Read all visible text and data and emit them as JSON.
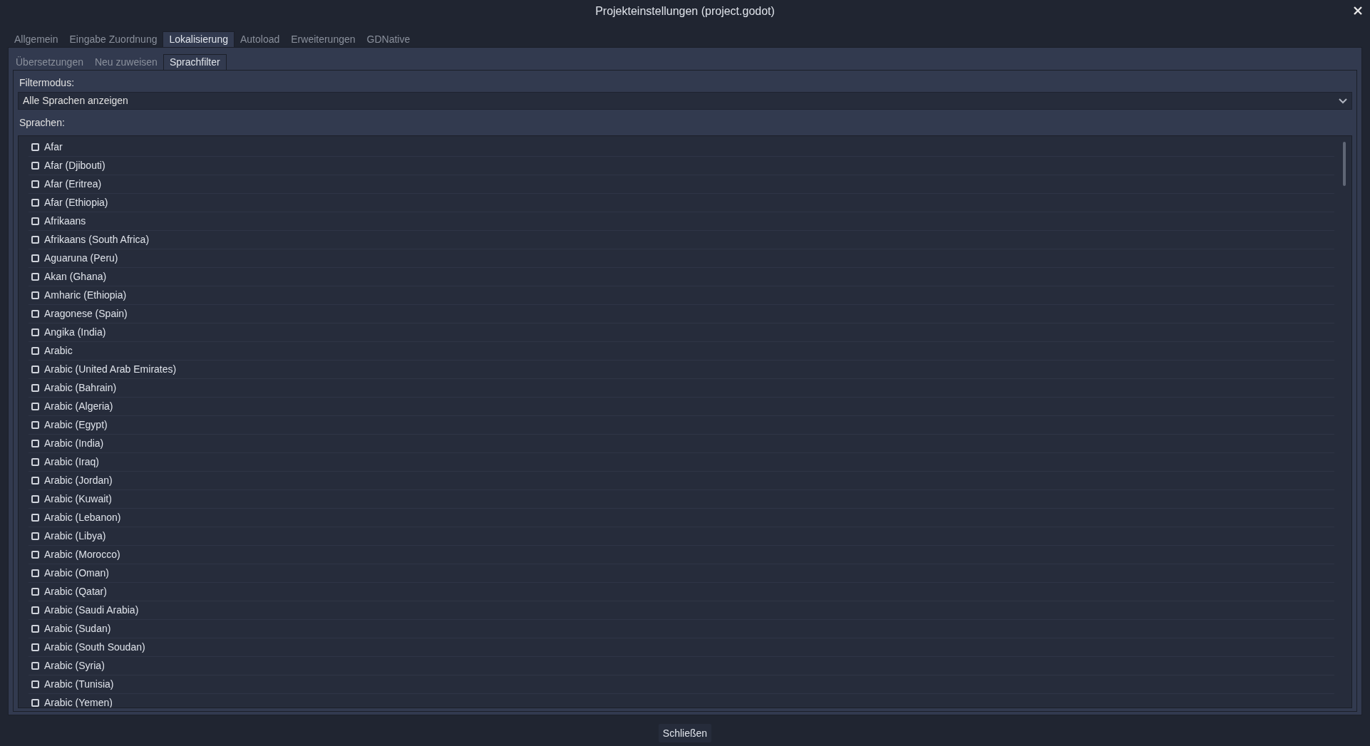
{
  "window": {
    "title": "Projekteinstellungen (project.godot)"
  },
  "tabs": [
    {
      "label": "Allgemein",
      "selected": false
    },
    {
      "label": "Eingabe Zuordnung",
      "selected": false
    },
    {
      "label": "Lokalisierung",
      "selected": true
    },
    {
      "label": "Autoload",
      "selected": false
    },
    {
      "label": "Erweiterungen",
      "selected": false
    },
    {
      "label": "GDNative",
      "selected": false
    }
  ],
  "subtabs": [
    {
      "label": "Übersetzungen",
      "selected": false
    },
    {
      "label": "Neu zuweisen",
      "selected": false
    },
    {
      "label": "Sprachfilter",
      "selected": true
    }
  ],
  "filter_mode": {
    "label": "Filtermodus:",
    "value": "Alle Sprachen anzeigen"
  },
  "languages": {
    "label": "Sprachen:",
    "items": [
      {
        "name": "Afar",
        "checked": false
      },
      {
        "name": "Afar (Djibouti)",
        "checked": false
      },
      {
        "name": "Afar (Eritrea)",
        "checked": false
      },
      {
        "name": "Afar (Ethiopia)",
        "checked": false
      },
      {
        "name": "Afrikaans",
        "checked": false
      },
      {
        "name": "Afrikaans (South Africa)",
        "checked": false
      },
      {
        "name": "Aguaruna (Peru)",
        "checked": false
      },
      {
        "name": "Akan (Ghana)",
        "checked": false
      },
      {
        "name": "Amharic (Ethiopia)",
        "checked": false
      },
      {
        "name": "Aragonese (Spain)",
        "checked": false
      },
      {
        "name": "Angika (India)",
        "checked": false
      },
      {
        "name": "Arabic",
        "checked": false
      },
      {
        "name": "Arabic (United Arab Emirates)",
        "checked": false
      },
      {
        "name": "Arabic (Bahrain)",
        "checked": false
      },
      {
        "name": "Arabic (Algeria)",
        "checked": false
      },
      {
        "name": "Arabic (Egypt)",
        "checked": false
      },
      {
        "name": "Arabic (India)",
        "checked": false
      },
      {
        "name": "Arabic (Iraq)",
        "checked": false
      },
      {
        "name": "Arabic (Jordan)",
        "checked": false
      },
      {
        "name": "Arabic (Kuwait)",
        "checked": false
      },
      {
        "name": "Arabic (Lebanon)",
        "checked": false
      },
      {
        "name": "Arabic (Libya)",
        "checked": false
      },
      {
        "name": "Arabic (Morocco)",
        "checked": false
      },
      {
        "name": "Arabic (Oman)",
        "checked": false
      },
      {
        "name": "Arabic (Qatar)",
        "checked": false
      },
      {
        "name": "Arabic (Saudi Arabia)",
        "checked": false
      },
      {
        "name": "Arabic (Sudan)",
        "checked": false
      },
      {
        "name": "Arabic (South Soudan)",
        "checked": false
      },
      {
        "name": "Arabic (Syria)",
        "checked": false
      },
      {
        "name": "Arabic (Tunisia)",
        "checked": false
      },
      {
        "name": "Arabic (Yemen)",
        "checked": false
      }
    ]
  },
  "buttons": [
    {
      "label": "Schließen"
    }
  ]
}
